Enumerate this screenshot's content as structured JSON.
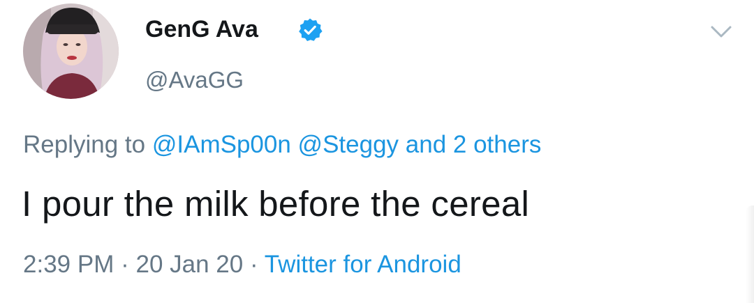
{
  "author": {
    "display_name": "GenG Ava",
    "handle": "@AvaGG",
    "verified": true
  },
  "reply_context": {
    "prefix": "Replying to",
    "mention_1": "@IAmSp00n",
    "mention_2": "@Steggy",
    "others": "and 2 others"
  },
  "tweet": {
    "text": "I pour the milk before the cereal"
  },
  "meta": {
    "time": "2:39 PM",
    "separator": "·",
    "date": "20 Jan 20",
    "source": "Twitter for Android"
  },
  "icons": {
    "verified": "verified-badge-icon",
    "menu": "chevron-down-icon"
  },
  "colors": {
    "link": "#1b95e0",
    "secondary_text": "#657786",
    "primary_text": "#14171a",
    "verified": "#1da1f2"
  }
}
